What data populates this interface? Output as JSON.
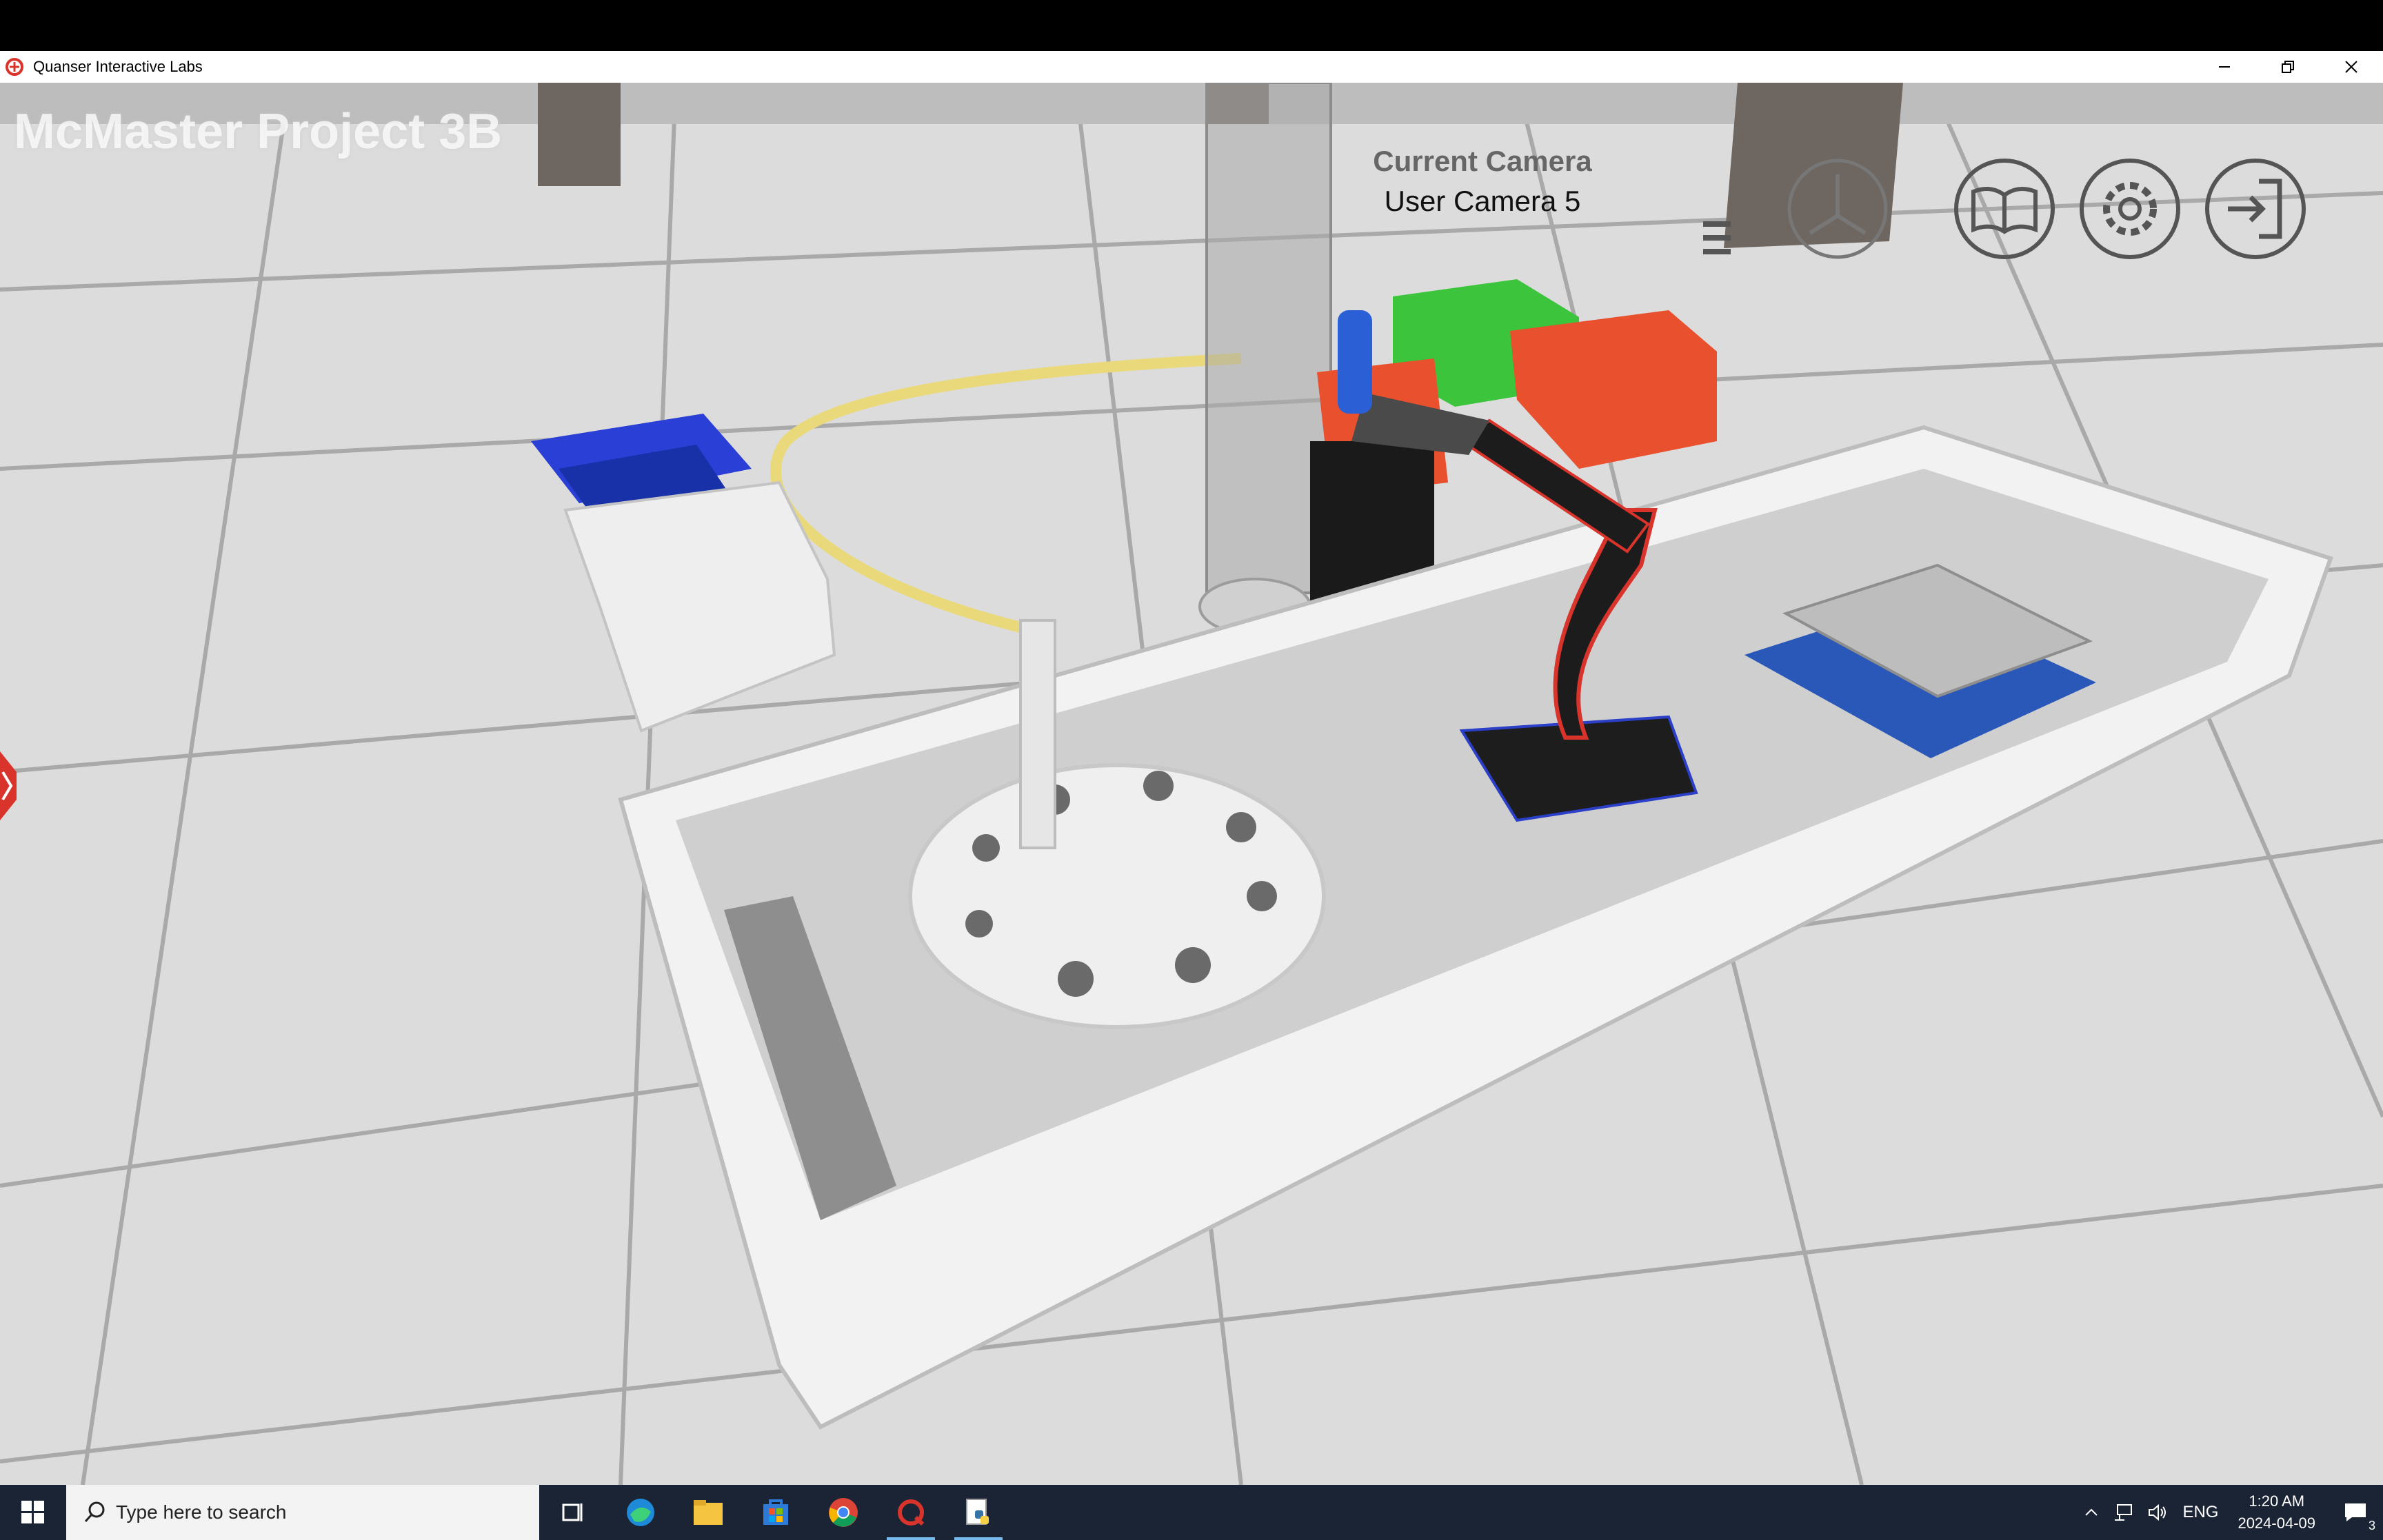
{
  "window": {
    "title": "Quanser Interactive Labs",
    "controls": [
      "minimize-icon",
      "restore-icon",
      "close-icon"
    ]
  },
  "overlay": {
    "project_title": "McMaster Project 3B",
    "camera_label": "Current Camera",
    "camera_value": "User Camera 5"
  },
  "hud_buttons": [
    "menu-icon",
    "axis-reset-icon",
    "book-icon",
    "gear-icon",
    "exit-icon"
  ],
  "taskbar": {
    "search_placeholder": "Type here to search",
    "apps": [
      "task-view-icon",
      "edge-icon",
      "file-explorer-icon",
      "store-icon",
      "chrome-icon",
      "quanser-icon",
      "python-icon"
    ],
    "tray": {
      "language": "ENG",
      "time": "1:20 AM",
      "date": "2024-04-09",
      "notifications": "3"
    }
  },
  "colors": {
    "floor": "#d8d8d8",
    "taskbar": "#1b2434",
    "bin_blue": "#2a3fd6",
    "bin_green": "#3cc43c",
    "bin_red": "#e8502e",
    "quanser_red": "#d9342b"
  }
}
